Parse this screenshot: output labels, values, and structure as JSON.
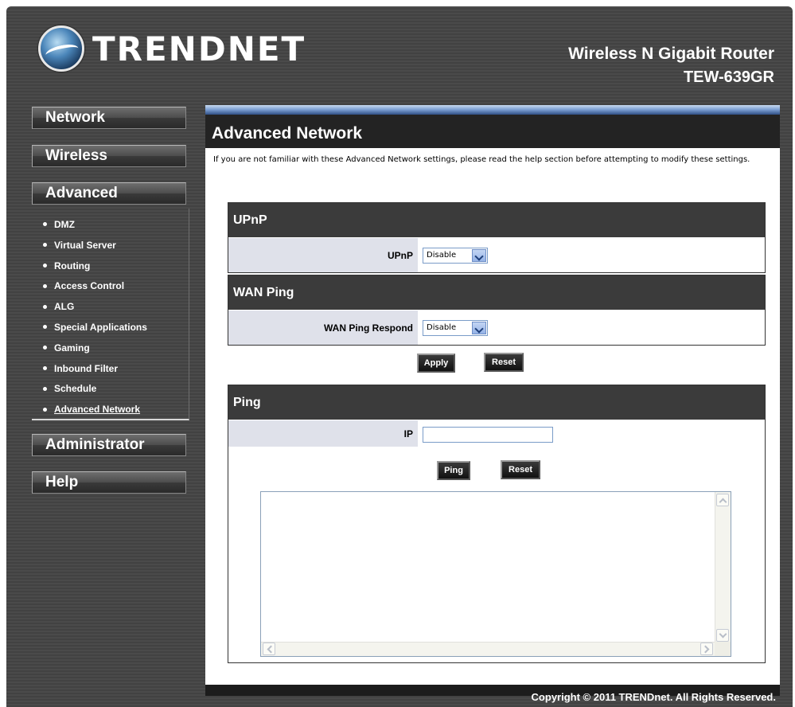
{
  "header": {
    "brand": "TRENDNET",
    "product": "Wireless N Gigabit Router",
    "model": "TEW-639GR"
  },
  "sidebar": {
    "network": "Network",
    "wireless": "Wireless",
    "advanced": "Advanced",
    "advanced_items": [
      {
        "label": "DMZ"
      },
      {
        "label": "Virtual Server"
      },
      {
        "label": "Routing"
      },
      {
        "label": "Access Control"
      },
      {
        "label": "ALG"
      },
      {
        "label": "Special Applications"
      },
      {
        "label": "Gaming"
      },
      {
        "label": "Inbound Filter"
      },
      {
        "label": "Schedule"
      },
      {
        "label": "Advanced Network",
        "active": true
      }
    ],
    "administrator": "Administrator",
    "help": "Help"
  },
  "main": {
    "title": "Advanced Network",
    "intro": "If you are not familiar with these Advanced Network settings, please read the help section before attempting to modify these settings.",
    "upnp": {
      "header": "UPnP",
      "label": "UPnP",
      "value": "Disable"
    },
    "wan_ping": {
      "header": "WAN Ping",
      "label": "WAN Ping Respond",
      "value": "Disable"
    },
    "apply_label": "Apply",
    "reset_label": "Reset",
    "ping": {
      "header": "Ping",
      "ip_label": "IP",
      "ip_value": "",
      "ping_label": "Ping",
      "reset_label": "Reset",
      "result": ""
    }
  },
  "footer": {
    "copyright": "Copyright © 2011 TRENDnet. All Rights Reserved."
  }
}
